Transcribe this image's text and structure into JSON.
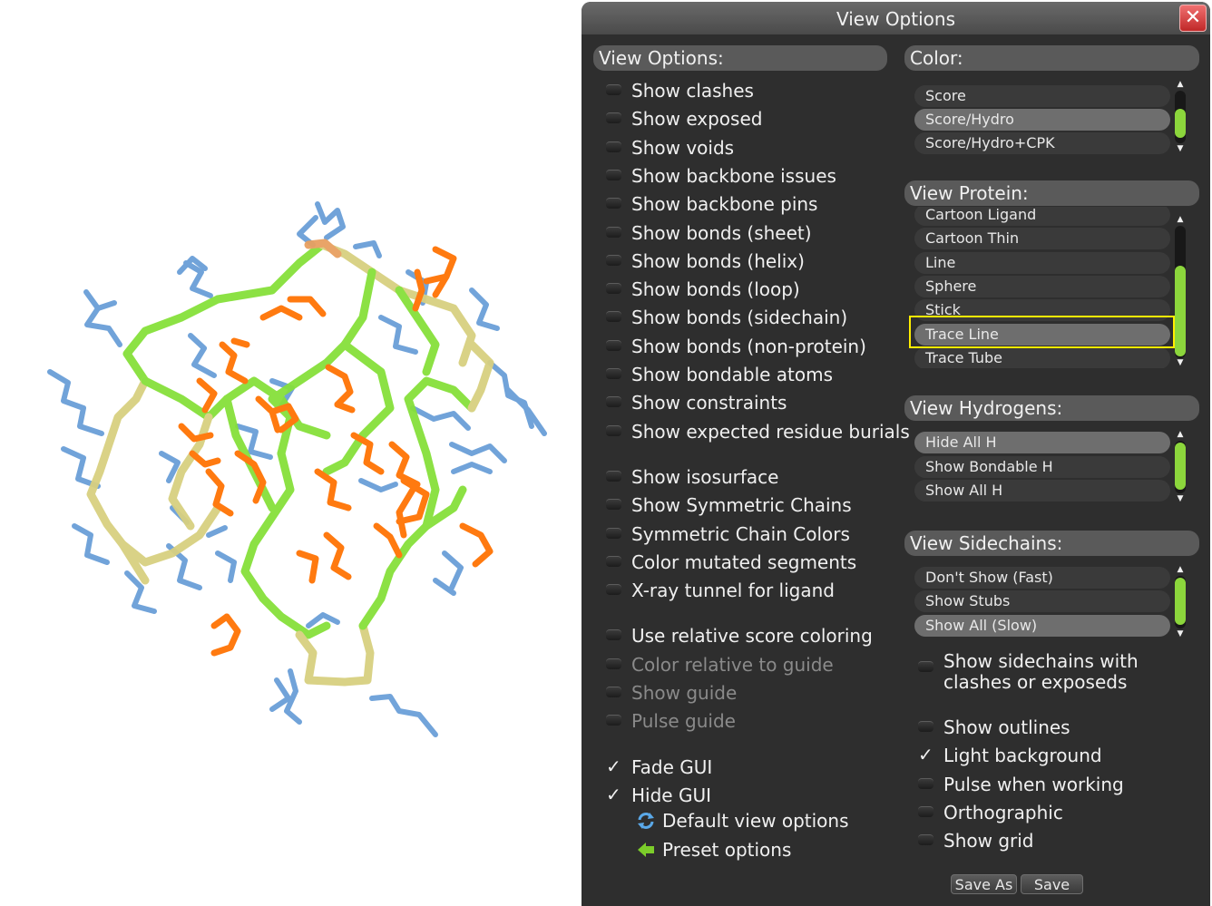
{
  "window": {
    "title": "View Options",
    "close_label": "✕"
  },
  "left_section": {
    "header": "View Options:",
    "options": [
      {
        "label": "Show clashes",
        "checked": false
      },
      {
        "label": "Show exposed",
        "checked": false
      },
      {
        "label": "Show voids",
        "checked": false
      },
      {
        "label": "Show backbone issues",
        "checked": false
      },
      {
        "label": "Show backbone pins",
        "checked": false
      },
      {
        "label": "Show bonds (sheet)",
        "checked": false
      },
      {
        "label": "Show bonds (helix)",
        "checked": false
      },
      {
        "label": "Show bonds (loop)",
        "checked": false
      },
      {
        "label": "Show bonds (sidechain)",
        "checked": false
      },
      {
        "label": "Show bonds (non-protein)",
        "checked": false
      },
      {
        "label": "Show bondable atoms",
        "checked": false
      },
      {
        "label": "Show constraints",
        "checked": false
      },
      {
        "label": "Show expected residue burials",
        "checked": false
      },
      {
        "label": "Show isosurface",
        "checked": false
      },
      {
        "label": "Show Symmetric Chains",
        "checked": false
      },
      {
        "label": "Symmetric Chain Colors",
        "checked": false
      },
      {
        "label": "Color mutated segments",
        "checked": false
      },
      {
        "label": "X-ray tunnel for ligand",
        "checked": false
      },
      {
        "label": "Use relative score coloring",
        "checked": false
      },
      {
        "label": "Color relative to guide",
        "checked": false,
        "disabled": true
      },
      {
        "label": "Show guide",
        "checked": false,
        "disabled": true
      },
      {
        "label": "Pulse guide",
        "checked": false,
        "disabled": true
      },
      {
        "label": "Fade GUI",
        "checked": true
      },
      {
        "label": "Hide GUI",
        "checked": true
      }
    ],
    "links": [
      {
        "label": "Default view options",
        "icon": "refresh-icon"
      },
      {
        "label": "Preset options",
        "icon": "arrow-left-icon"
      }
    ]
  },
  "color_section": {
    "header": "Color:",
    "items": [
      {
        "label": "Score",
        "selected": false
      },
      {
        "label": "Score/Hydro",
        "selected": true
      },
      {
        "label": "Score/Hydro+CPK",
        "selected": false
      }
    ]
  },
  "protein_section": {
    "header": "View Protein:",
    "items": [
      {
        "label": "Cartoon Ligand",
        "selected": false
      },
      {
        "label": "Cartoon Thin",
        "selected": false
      },
      {
        "label": "Line",
        "selected": false
      },
      {
        "label": "Sphere",
        "selected": false
      },
      {
        "label": "Stick",
        "selected": false
      },
      {
        "label": "Trace Line",
        "selected": true
      },
      {
        "label": "Trace Tube",
        "selected": false
      }
    ]
  },
  "hydrogens_section": {
    "header": "View Hydrogens:",
    "items": [
      {
        "label": "Hide All H",
        "selected": true
      },
      {
        "label": "Show Bondable H",
        "selected": false
      },
      {
        "label": "Show All H",
        "selected": false
      }
    ]
  },
  "sidechains_section": {
    "header": "View Sidechains:",
    "items": [
      {
        "label": "Don't Show (Fast)",
        "selected": false
      },
      {
        "label": "Show Stubs",
        "selected": false
      },
      {
        "label": "Show All (Slow)",
        "selected": true
      }
    ],
    "sidechain_option": {
      "line1": "Show sidechains with",
      "line2": "clashes or exposeds",
      "checked": false
    }
  },
  "right_options": [
    {
      "label": "Show outlines",
      "checked": false
    },
    {
      "label": "Light background",
      "checked": true
    },
    {
      "label": "Pulse when working",
      "checked": false
    },
    {
      "label": "Orthographic",
      "checked": false
    },
    {
      "label": "Show grid",
      "checked": false
    }
  ],
  "buttons": {
    "save_as": "Save As",
    "save": "Save"
  },
  "colors": {
    "panel_bg": "#2e2e2e",
    "header_bg": "#5a5a5a",
    "scroll_thumb": "#8cd63c",
    "highlight": "#ffee00",
    "sidechain_hydrophobic": "#ff7a10",
    "sidechain_polar": "#6a9fd8",
    "backbone_good": "#86e03a",
    "backbone_mid": "#d8d080",
    "backbone_bad": "#e8a060"
  }
}
